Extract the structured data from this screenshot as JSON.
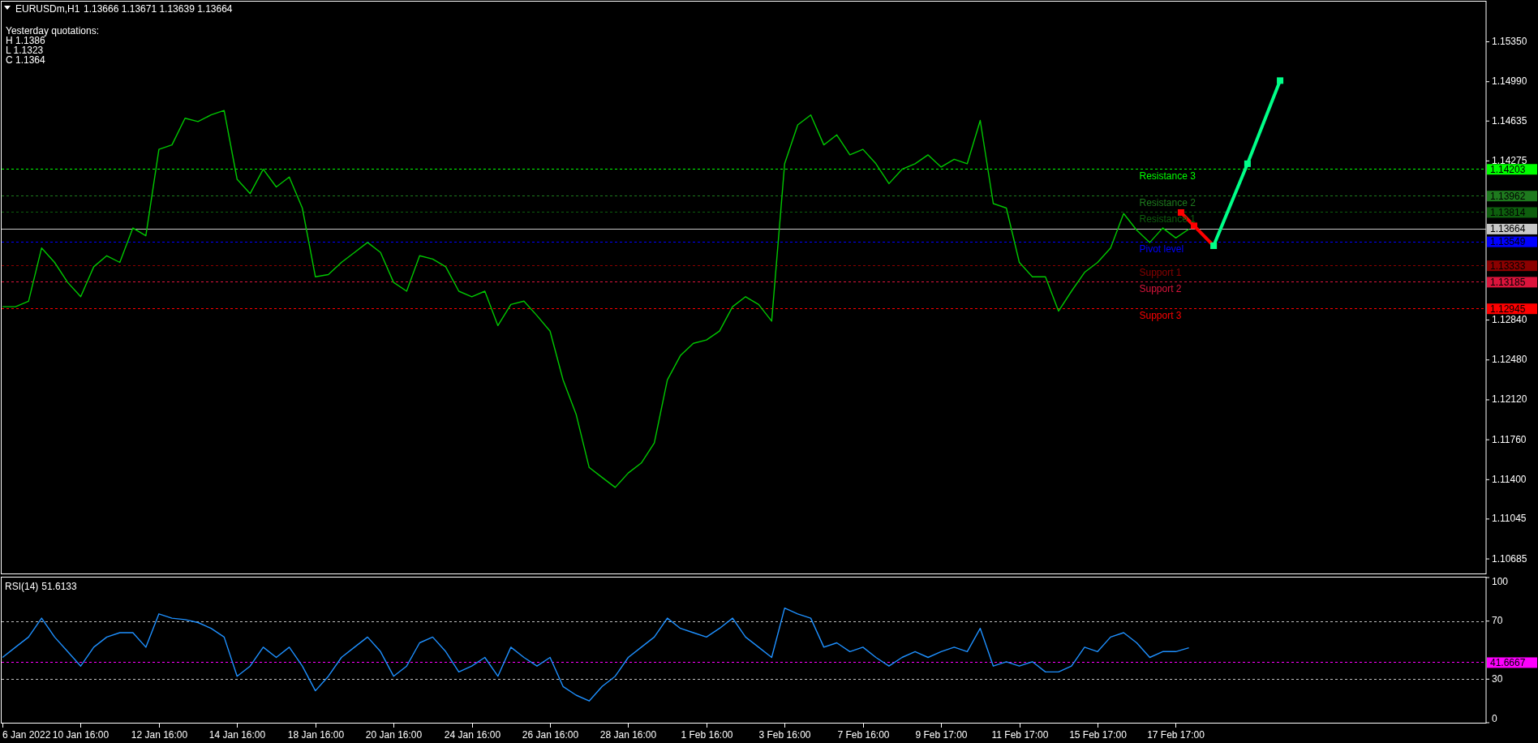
{
  "price_panel": {
    "symbol": "EURUSDm,H1",
    "quotes": "1.13666 1.13671 1.13639 1.13664",
    "yesterday": {
      "title": "Yesterday quotations:",
      "lines": [
        "H 1.1386",
        "L 1.1323",
        "C 1.1364"
      ]
    },
    "price_tags": [
      "1.14203",
      "1.13962",
      "1.13814",
      "1.13664",
      "1.13549",
      "1.13333",
      "1.13185",
      "1.12945"
    ],
    "chart_data": {
      "type": "line",
      "ylim": [
        1.10561,
        1.15705
      ],
      "categories": [
        null,
        null,
        null,
        null,
        null,
        null,
        null,
        null,
        null,
        null,
        null,
        null,
        null,
        null,
        null,
        null,
        null,
        null,
        null,
        null,
        null,
        null,
        null,
        null,
        null,
        null,
        null,
        null,
        null,
        null,
        null,
        null,
        null,
        null,
        null,
        null,
        null,
        null,
        null,
        null,
        null,
        null,
        null,
        null,
        null,
        null,
        null,
        null,
        null,
        null,
        null,
        null,
        null,
        null,
        null,
        null,
        null,
        null,
        null,
        null,
        null,
        null,
        null,
        null,
        null,
        null,
        null,
        null,
        null,
        null,
        null,
        null,
        null,
        null,
        null,
        null,
        null,
        null,
        null,
        null,
        null,
        null,
        null,
        null,
        null,
        null,
        null,
        null,
        null,
        null,
        null,
        null
      ],
      "yticks": [
        {
          "value": 1.1535,
          "label": "1.15350"
        },
        {
          "value": 1.1499,
          "label": "1.14990"
        },
        {
          "value": 1.14635,
          "label": "1.14635"
        },
        {
          "value": 1.14275,
          "label": "1.14275"
        },
        {
          "value": 1.1284,
          "label": "1.12840"
        },
        {
          "value": 1.1248,
          "label": "1.12480"
        },
        {
          "value": 1.1212,
          "label": "1.12120"
        },
        {
          "value": 1.1176,
          "label": "1.11760"
        },
        {
          "value": 1.114,
          "label": "1.11400"
        },
        {
          "value": 1.11045,
          "label": "1.11045"
        },
        {
          "value": 1.10685,
          "label": "1.10685"
        }
      ],
      "series": [
        {
          "color": "#00c800",
          "values": [
            1.1296,
            1.1296,
            1.1301,
            1.1349,
            1.1336,
            1.1318,
            1.1305,
            1.1332,
            1.1342,
            1.1336,
            1.1367,
            1.136,
            1.1438,
            1.1442,
            1.1466,
            1.1463,
            1.1469,
            1.1473,
            1.1411,
            1.1398,
            1.142,
            1.1404,
            1.1413,
            1.1385,
            1.1323,
            1.1325,
            1.1336,
            1.1345,
            1.1354,
            1.1345,
            1.1318,
            1.131,
            1.1342,
            1.1339,
            1.1332,
            1.131,
            1.1305,
            1.131,
            1.1279,
            1.1298,
            1.1301,
            1.1288,
            1.1274,
            1.123,
            1.1199,
            1.1151,
            1.1142,
            1.1133,
            1.1146,
            1.1155,
            1.1173,
            1.123,
            1.1252,
            1.1263,
            1.1266,
            1.1274,
            1.1296,
            1.1305,
            1.1298,
            1.1283,
            1.1425,
            1.146,
            1.1469,
            1.1442,
            1.1451,
            1.1433,
            1.1438,
            1.1425,
            1.1407,
            1.142,
            1.1425,
            1.1433,
            1.1422,
            1.1429,
            1.1425,
            1.1464,
            1.1389,
            1.1385,
            1.1336,
            1.1323,
            1.1323,
            1.1292,
            1.131,
            1.1327,
            1.1336,
            1.1349,
            1.138,
            1.1365,
            1.1354,
            1.1367,
            1.1358,
            1.1366
          ]
        }
      ],
      "ref_lines": [
        {
          "axis": "y",
          "value": 1.14203,
          "color": "#00ff00",
          "label": "Resistance 3"
        },
        {
          "axis": "y",
          "value": 1.13962,
          "color": "#1e7a1e",
          "label": "Resistance 2"
        },
        {
          "axis": "y",
          "value": 1.13814,
          "color": "#0d5e0d",
          "label": "Resistance 1"
        },
        {
          "axis": "y",
          "value": 1.13664,
          "color": "#c8c8c8"
        },
        {
          "axis": "y",
          "value": 1.13549,
          "color": "#0000ff",
          "label": "Pivot level"
        },
        {
          "axis": "y",
          "value": 1.13333,
          "color": "#8b0000",
          "label": "Support 1"
        },
        {
          "axis": "y",
          "value": 1.13185,
          "color": "#dc143c",
          "label": "Support 2"
        },
        {
          "axis": "y",
          "value": 1.12945,
          "color": "#ff0000",
          "label": "Support 3"
        }
      ]
    }
  },
  "rsi_panel": {
    "reading": "51.6133",
    "price_tags": [
      "41.6667"
    ],
    "start_time_label": "6 Jan 2022",
    "chart_data": {
      "type": "line",
      "ylim": [
        0,
        100
      ],
      "categories": [
        null,
        null,
        null,
        null,
        null,
        null,
        "10 Jan 16:00",
        null,
        null,
        null,
        null,
        null,
        "12 Jan 16:00",
        null,
        null,
        null,
        null,
        null,
        "14 Jan 16:00",
        null,
        null,
        null,
        null,
        null,
        "18 Jan 16:00",
        null,
        null,
        null,
        null,
        null,
        "20 Jan 16:00",
        null,
        null,
        null,
        null,
        null,
        "24 Jan 16:00",
        null,
        null,
        null,
        null,
        null,
        "26 Jan 16:00",
        null,
        null,
        null,
        null,
        null,
        "28 Jan 16:00",
        null,
        null,
        null,
        null,
        null,
        "1 Feb 16:00",
        null,
        null,
        null,
        null,
        null,
        "3 Feb 16:00",
        null,
        null,
        null,
        null,
        null,
        "7 Feb 16:00",
        null,
        null,
        null,
        null,
        null,
        "9 Feb 17:00",
        null,
        null,
        null,
        null,
        null,
        "11 Feb 17:00",
        null,
        null,
        null,
        null,
        null,
        "15 Feb 17:00",
        null,
        null,
        null,
        null,
        null,
        "17 Feb 17:00",
        null
      ],
      "yticks": [
        100,
        70,
        30,
        0
      ],
      "series": [
        {
          "name": "RSI(14)",
          "color": "#1e90ff",
          "values": [
            45,
            52,
            59,
            72,
            59,
            49,
            39,
            52,
            59,
            62,
            62,
            52,
            75,
            72,
            71,
            69,
            65,
            59,
            32,
            39,
            52,
            45,
            52,
            39,
            22,
            32,
            45,
            52,
            59,
            49,
            32,
            39,
            55,
            59,
            49,
            35,
            39,
            45,
            32,
            52,
            45,
            39,
            45,
            25,
            19,
            15,
            25,
            32,
            45,
            52,
            59,
            72,
            65,
            62,
            59,
            65,
            72,
            59,
            52,
            45,
            79,
            75,
            72,
            52,
            55,
            49,
            52,
            45,
            39,
            45,
            49,
            45,
            49,
            52,
            49,
            65,
            39,
            42,
            39,
            42,
            35,
            35,
            39,
            52,
            49,
            59,
            62,
            55,
            45,
            49,
            49,
            51.6
          ]
        }
      ],
      "ref_lines": [
        {
          "axis": "y",
          "value": 70,
          "color": "#c0c0c0"
        },
        {
          "axis": "y",
          "value": 30,
          "color": "#c0c0c0"
        },
        {
          "axis": "y",
          "value": 41.6667,
          "color": "#ff00ff"
        }
      ]
    }
  }
}
